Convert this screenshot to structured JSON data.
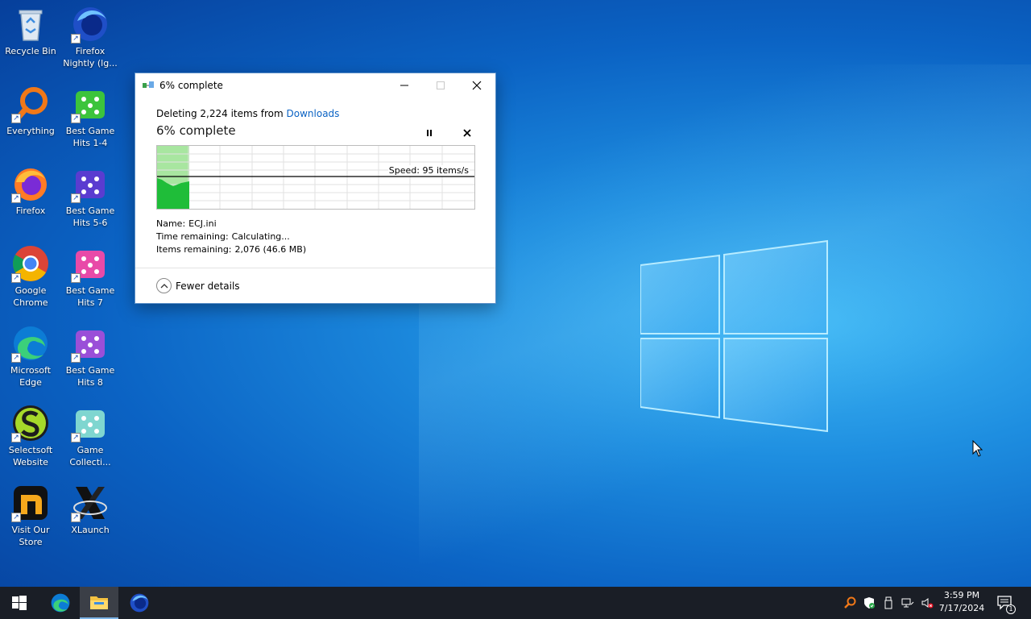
{
  "desktop": {
    "icons": [
      {
        "label": "Recycle Bin",
        "icon": "recycle-bin-icon"
      },
      {
        "label": "Firefox Nightly (lg...",
        "icon": "firefox-nightly-icon"
      },
      {
        "label": "Everything",
        "icon": "everything-search-icon"
      },
      {
        "label": "Best Game Hits 1-4",
        "icon": "dice-green-icon"
      },
      {
        "label": "Firefox",
        "icon": "firefox-icon"
      },
      {
        "label": "Best Game Hits 5-6",
        "icon": "dice-purple-icon"
      },
      {
        "label": "Google Chrome",
        "icon": "chrome-icon"
      },
      {
        "label": "Best Game Hits 7",
        "icon": "dice-pink-icon"
      },
      {
        "label": "Microsoft Edge",
        "icon": "edge-icon"
      },
      {
        "label": "Best Game Hits 8",
        "icon": "dice-violet-icon"
      },
      {
        "label": "Selectsoft Website",
        "icon": "selectsoft-icon"
      },
      {
        "label": "Game Collecti...",
        "icon": "dice-teal-icon"
      },
      {
        "label": "Visit Our Store",
        "icon": "store-n-icon"
      },
      {
        "label": "XLaunch",
        "icon": "xlaunch-icon"
      }
    ]
  },
  "dialog": {
    "window_title": "6% complete",
    "operation_prefix": "Deleting 2,224 items from",
    "operation_location": "Downloads",
    "heading": "6% complete",
    "progress_percent": 6,
    "speed": "Speed: 95 items/s",
    "name_key": "Name:",
    "name_value": "ECJ.ini",
    "time_key": "Time remaining:",
    "time_value": "Calculating...",
    "items_key": "Items remaining:",
    "items_value": "2,076 (46.6 MB)",
    "fewer_details": "Fewer details"
  },
  "taskbar": {
    "time": "3:59 PM",
    "date": "7/17/2024",
    "notification_count": "1"
  },
  "colors": {
    "accent": "#0b63c4",
    "progress_green": "#1fbd39",
    "progress_light": "#a8e6a0",
    "taskbar": "#1a1e26"
  }
}
